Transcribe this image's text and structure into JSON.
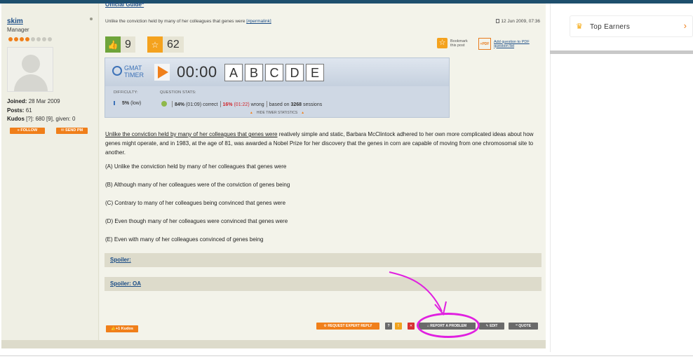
{
  "user": {
    "username": "skim",
    "role": "Manager",
    "joined_label": "Joined:",
    "joined_value": "28 Mar 2009",
    "posts_label": "Posts:",
    "posts_value": "61",
    "kudos_label": "Kudos",
    "kudos_text": "[?]: 680 [9], given: 0",
    "follow_label": "FOLLOW",
    "send_pm_label": "SEND PM"
  },
  "post": {
    "guide_link": "Official Guide*",
    "subject": "Unlike the conviction held by many of her colleagues that genes were",
    "permalink": "[#permalink]",
    "date": "12 Jun 2009, 07:36",
    "likes": "9",
    "favorites": "62",
    "bookmark_label": "Bookmark this post",
    "pdf_icon_label": "+PDF",
    "pdf_link": "Add question to PDF question list"
  },
  "timer": {
    "logo_line1": "GMAT",
    "logo_line2": "TIMER",
    "time": "00:00",
    "answers": [
      "A",
      "B",
      "C",
      "D",
      "E"
    ],
    "difficulty_label": "DIFFICULTY:",
    "difficulty_value": "5%",
    "difficulty_note": "(low)",
    "stats_label": "QUESTION STATS:",
    "correct_pct": "84%",
    "correct_time": "(01:09) correct",
    "wrong_pct": "16%",
    "wrong_time": "(01:22)",
    "wrong_label": "wrong",
    "based_on": "based on",
    "sessions": "3268",
    "sessions_label": "sessions",
    "hide_label": "HIDE TIMER STATISTICS"
  },
  "question": {
    "underlined": "Unlike the conviction held by many of her colleagues that genes were",
    "rest": " reatively simple and static, Barbara McClintock adhered to her own more complicated ideas about how genes might operate, and in 1983, at the age of 81, was awarded a Nobel Prize for her discovery that the genes in corn are capable of moving from one chromosomal site to another.",
    "choices": [
      "(A) Unlike the conviction held by many of her colleagues that genes were",
      "(B) Although many of her colleagues were of the conviction of genes being",
      "(C) Contrary to many of her colleagues being convinced that genes were",
      "(D) Even though many of her colleagues were convinced that genes were",
      "(E) Even with many of her colleagues convinced of genes being"
    ],
    "spoiler1": "Spoiler:",
    "spoiler2": "Spoiler: OA"
  },
  "actions": {
    "kudos": "+1 Kudos",
    "request_expert": "REQUEST EXPERT REPLY",
    "help": "?",
    "report": "REPORT A PROBLEM",
    "edit": "EDIT",
    "quote": "QUOTE"
  },
  "right": {
    "top_earners": "Top Earners"
  },
  "colors": {
    "accent": "#f07f1a",
    "link": "#1a4c86",
    "annotation": "#e020e0",
    "wrong": "#d0262b"
  }
}
